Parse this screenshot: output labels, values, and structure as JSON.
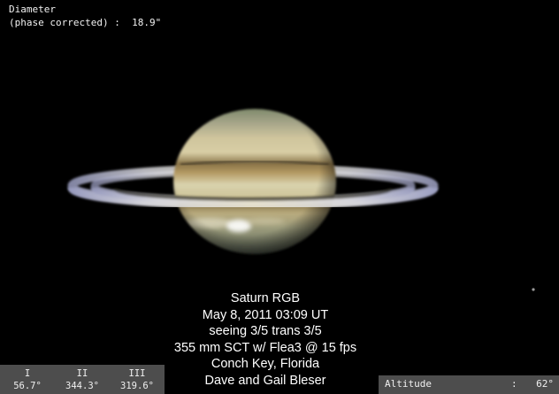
{
  "diameter": {
    "label": "Diameter",
    "line2": "(phase corrected) :  18.9\""
  },
  "caption": [
    "Saturn RGB",
    "May 8, 2011  03:09 UT",
    "seeing 3/5 trans 3/5",
    "355 mm SCT w/ Flea3 @ 15 fps",
    "Conch Key, Florida",
    "Dave and Gail Bleser"
  ],
  "central_meridians": [
    {
      "system": "I",
      "value": "56.7°"
    },
    {
      "system": "II",
      "value": "344.3°"
    },
    {
      "system": "III",
      "value": "319.6°"
    }
  ],
  "altitude": {
    "label": "Altitude",
    "separator": ":",
    "value": "62°"
  },
  "colors": {
    "background": "#000000",
    "info_box": "#4d4d4d",
    "text": "#ffffff",
    "planet_belt": "#8c7a4c",
    "planet_zone": "#d8cfa8",
    "ring": "#c8c8d0",
    "storm": "#f4f4e8"
  }
}
